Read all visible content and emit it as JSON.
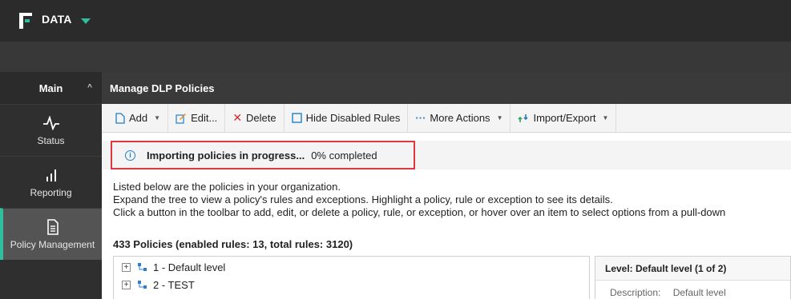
{
  "app": {
    "name": "DATA"
  },
  "sidebar": {
    "header": "Main",
    "items": [
      {
        "label": "Status",
        "icon": "pulse-icon"
      },
      {
        "label": "Reporting",
        "icon": "bar-chart-icon"
      },
      {
        "label": "Policy Management",
        "icon": "document-icon",
        "active": true
      }
    ]
  },
  "page": {
    "title": "Manage DLP Policies"
  },
  "toolbar": {
    "add": "Add",
    "edit": "Edit...",
    "delete": "Delete",
    "hide_disabled": "Hide Disabled Rules",
    "more_actions": "More Actions",
    "import_export": "Import/Export"
  },
  "notice": {
    "bold": "Importing policies in progress...",
    "rest": "0% completed"
  },
  "description": {
    "line1": "Listed below are the policies in your organization.",
    "line2": "Expand the tree to view a policy's rules and exceptions. Highlight a policy, rule or exception to see its details.",
    "line3": "Click a button in the toolbar to add, edit, or delete a policy, rule, or exception, or hover over an item to select options from a pull-down"
  },
  "summary": "433 Policies (enabled rules: 13, total rules: 3120)",
  "tree": [
    {
      "label": "1 - Default level"
    },
    {
      "label": "2 - TEST"
    }
  ],
  "detail": {
    "title": "Level: Default level (1 of 2)",
    "key": "Description:",
    "value": "Default level"
  },
  "colors": {
    "accent": "#2fbf9f",
    "highlight_border": "#e0363c",
    "info": "#1f7fc9"
  }
}
